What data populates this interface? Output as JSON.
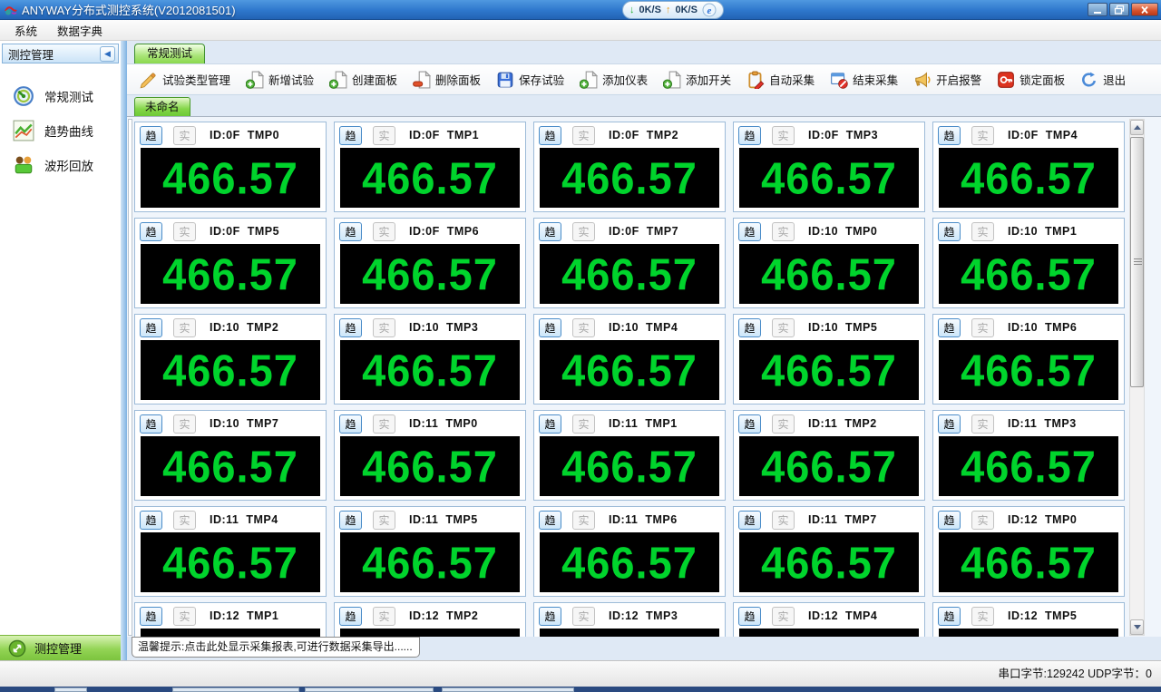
{
  "window": {
    "title": "ANYWAY分布式测控系统(V2012081501)",
    "net": {
      "down_arrow": "↓",
      "down_label": "0K/S",
      "up_arrow": "↑",
      "up_label": "0K/S"
    }
  },
  "menu": {
    "items": [
      "系统",
      "数据字典"
    ]
  },
  "sidebar": {
    "header": "测控管理",
    "collapse_glyph": "◀",
    "items": [
      {
        "icon": "gauge-icon",
        "label": "常规测试"
      },
      {
        "icon": "trend-icon",
        "label": "趋势曲线"
      },
      {
        "icon": "replay-icon",
        "label": "波形回放"
      }
    ],
    "footer": "测控管理"
  },
  "tabs": {
    "main": "常规测试",
    "page": "未命名"
  },
  "toolbar": {
    "items": [
      {
        "icon": "pencil-icon",
        "label": "试验类型管理"
      },
      {
        "icon": "add-page-icon",
        "label": "新增试验"
      },
      {
        "icon": "add-page-icon",
        "label": "创建面板"
      },
      {
        "icon": "remove-page-icon",
        "label": "删除面板"
      },
      {
        "icon": "save-icon",
        "label": "保存试验"
      },
      {
        "icon": "add-page-icon",
        "label": "添加仪表"
      },
      {
        "icon": "add-page-icon",
        "label": "添加开关"
      },
      {
        "icon": "auto-collect-icon",
        "label": "自动采集"
      },
      {
        "icon": "stop-collect-icon",
        "label": "结束采集"
      },
      {
        "icon": "alarm-icon",
        "label": "开启报警"
      },
      {
        "icon": "lock-icon",
        "label": "锁定面板"
      },
      {
        "icon": "exit-icon",
        "label": "退出"
      }
    ]
  },
  "meters": {
    "trend_button": "趋",
    "real_button": "实",
    "value": "466.57",
    "value_color": "#00D42C",
    "display_bg": "#000000",
    "panels": [
      "ID:0F  TMP0",
      "ID:0F  TMP1",
      "ID:0F  TMP2",
      "ID:0F  TMP3",
      "ID:0F  TMP4",
      "ID:0F  TMP5",
      "ID:0F  TMP6",
      "ID:0F  TMP7",
      "ID:10  TMP0",
      "ID:10  TMP1",
      "ID:10  TMP2",
      "ID:10  TMP3",
      "ID:10  TMP4",
      "ID:10  TMP5",
      "ID:10  TMP6",
      "ID:10  TMP7",
      "ID:11  TMP0",
      "ID:11  TMP1",
      "ID:11  TMP2",
      "ID:11  TMP3",
      "ID:11  TMP4",
      "ID:11  TMP5",
      "ID:11  TMP6",
      "ID:11  TMP7",
      "ID:12  TMP0",
      "ID:12  TMP1",
      "ID:12  TMP2",
      "ID:12  TMP3",
      "ID:12  TMP4",
      "ID:12  TMP5"
    ]
  },
  "statusbar": {
    "tip": "温馨提示:点击此处显示采集报表,可进行数据采集导出......",
    "right": "串口字节:129242  UDP字节：0"
  },
  "colors": {
    "titlebar_blue": "#2E77CC",
    "tab_green": "#8AD84E",
    "value_green": "#00D42C",
    "footer_green": "#93D455"
  }
}
